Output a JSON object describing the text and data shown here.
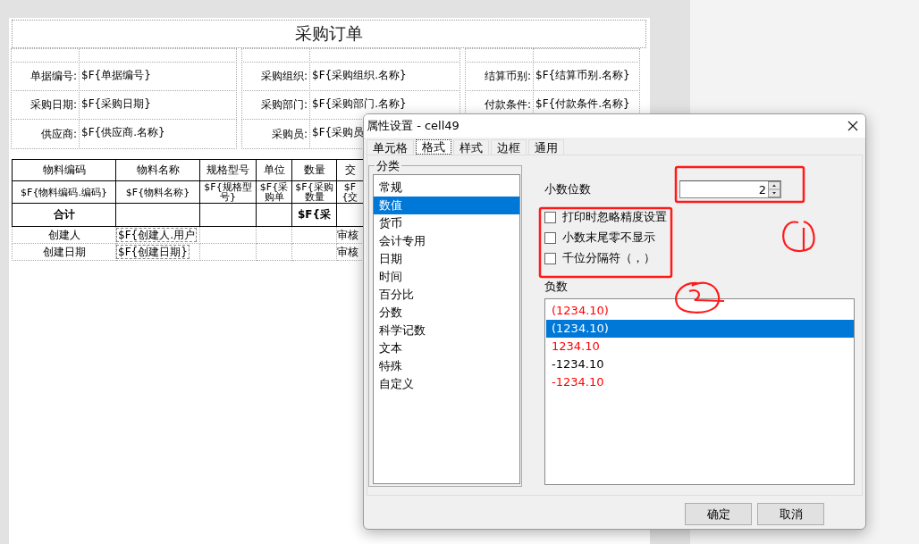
{
  "document": {
    "title": "采购订单",
    "header_rows": [
      [
        {
          "label": "单据编号:",
          "value": "$F{单据编号}"
        },
        {
          "label": "采购组织:",
          "value": "$F{采购组织.名称}"
        },
        {
          "label": "结算币别:",
          "value": "$F{结算币别.名称}"
        }
      ],
      [
        {
          "label": "采购日期:",
          "value": "$F{采购日期}"
        },
        {
          "label": "采购部门:",
          "value": "$F{采购部门.名称}"
        },
        {
          "label": "付款条件:",
          "value": "$F{付款条件.名称}"
        }
      ],
      [
        {
          "label": "供应商:",
          "value": "$F{供应商.名称}"
        },
        {
          "label": "采购员:",
          "value": "$F{采购员"
        }
      ]
    ],
    "detail_table": {
      "columns": [
        "物料编码",
        "物料名称",
        "规格型号",
        "单位",
        "数量",
        "交"
      ],
      "rows": [
        {
          "kind": "data",
          "cells": [
            "$F{物料编码.编码}",
            "$F{物料名称}",
            "$F{规格型号}",
            "$F{采购单",
            "$F{采购数量",
            "$F{交"
          ]
        },
        {
          "kind": "total",
          "label": "合计",
          "quantity": "$F{采"
        },
        {
          "kind": "footer",
          "label": "创建人",
          "value": "$F{创建人.用户",
          "right_label": "审核"
        },
        {
          "kind": "footer",
          "label": "创建日期",
          "value": "$F{创建日期}",
          "right_label": "审核"
        }
      ]
    }
  },
  "dialog": {
    "title": "属性设置 - cell49",
    "tabs": [
      {
        "label": "单元格",
        "selected": false
      },
      {
        "label": "格式",
        "selected": true
      },
      {
        "label": "样式",
        "selected": false
      },
      {
        "label": "边框",
        "selected": false
      },
      {
        "label": "通用",
        "selected": false
      }
    ],
    "category_group": {
      "title": "分类",
      "items": [
        {
          "label": "常规",
          "selected": false
        },
        {
          "label": "数值",
          "selected": true
        },
        {
          "label": "货币",
          "selected": false
        },
        {
          "label": "会计专用",
          "selected": false
        },
        {
          "label": "日期",
          "selected": false
        },
        {
          "label": "时间",
          "selected": false
        },
        {
          "label": "百分比",
          "selected": false
        },
        {
          "label": "分数",
          "selected": false
        },
        {
          "label": "科学记数",
          "selected": false
        },
        {
          "label": "文本",
          "selected": false
        },
        {
          "label": "特殊",
          "selected": false
        },
        {
          "label": "自定义",
          "selected": false
        }
      ]
    },
    "decimal_places": {
      "label": "小数位数",
      "value": "2"
    },
    "options": [
      {
        "label": "打印时忽略精度设置",
        "checked": false
      },
      {
        "label": "小数末尾零不显示",
        "checked": false
      },
      {
        "label": "千位分隔符（，）",
        "checked": false
      }
    ],
    "negative_numbers": {
      "label": "负数",
      "items": [
        {
          "text": "(1234.10)",
          "color": "#ff0000",
          "selected": false
        },
        {
          "text": "(1234.10)",
          "selected": true
        },
        {
          "text": "1234.10",
          "color": "#ff0000",
          "selected": false
        },
        {
          "text": "-1234.10",
          "color": "#000000",
          "selected": false
        },
        {
          "text": "-1234.10",
          "color": "#ff0000",
          "selected": false
        }
      ]
    },
    "buttons": [
      {
        "label": "确定"
      },
      {
        "label": "取消"
      }
    ]
  }
}
